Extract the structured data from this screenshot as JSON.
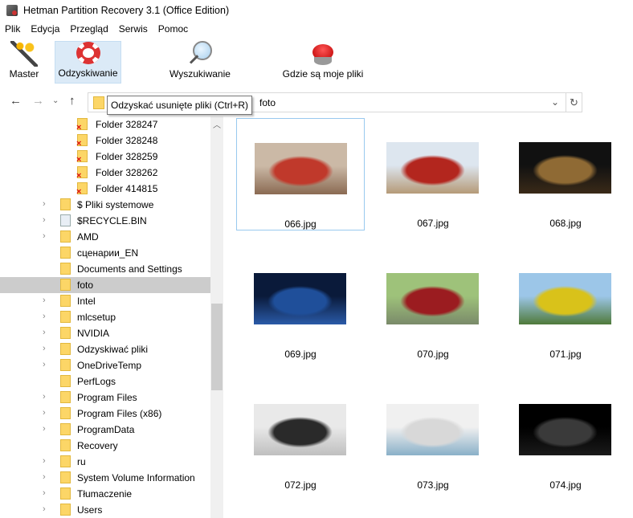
{
  "window": {
    "title": "Hetman Partition Recovery 3.1 (Office Edition)"
  },
  "menu": [
    "Plik",
    "Edycja",
    "Przegląd",
    "Serwis",
    "Pomoc"
  ],
  "toolbar": [
    {
      "label": "Master",
      "icon": "wizard-wand-icon"
    },
    {
      "label": "Odzyskiwanie",
      "icon": "lifebuoy-icon",
      "active": true
    },
    {
      "label": "Wyszukiwanie",
      "icon": "magnifier-icon"
    },
    {
      "label": "Gdzie są moje pliki",
      "icon": "help-button-icon"
    }
  ],
  "address": {
    "current": "foto",
    "separator": "›",
    "tooltip": "Odzyskać usunięte pliki (Ctrl+R)"
  },
  "tree": [
    {
      "label": "Folder 328247",
      "deleted": true
    },
    {
      "label": "Folder 328248",
      "deleted": true
    },
    {
      "label": "Folder 328259",
      "deleted": true
    },
    {
      "label": "Folder 328262",
      "deleted": true
    },
    {
      "label": "Folder 414815",
      "deleted": true
    },
    {
      "label": "$ Pliki systemowe",
      "expandable": true
    },
    {
      "label": "$RECYCLE.BIN",
      "expandable": true,
      "recycle": true
    },
    {
      "label": "AMD",
      "expandable": true
    },
    {
      "label": "сценарии_EN"
    },
    {
      "label": "Documents and Settings"
    },
    {
      "label": "foto",
      "selected": true
    },
    {
      "label": "Intel",
      "expandable": true
    },
    {
      "label": "mlcsetup",
      "expandable": true
    },
    {
      "label": "NVIDIA",
      "expandable": true
    },
    {
      "label": "Odzyskiwać pliki",
      "expandable": true
    },
    {
      "label": "OneDriveTemp",
      "expandable": true
    },
    {
      "label": "PerfLogs"
    },
    {
      "label": "Program Files",
      "expandable": true
    },
    {
      "label": "Program Files (x86)",
      "expandable": true
    },
    {
      "label": "ProgramData",
      "expandable": true
    },
    {
      "label": "Recovery"
    },
    {
      "label": "ru",
      "expandable": true
    },
    {
      "label": "System Volume Information",
      "expandable": true
    },
    {
      "label": "Tłumaczenie",
      "expandable": true
    },
    {
      "label": "Users",
      "expandable": true
    }
  ],
  "files": [
    {
      "name": "066.jpg",
      "selected": true,
      "colors": [
        "#cbb9a6",
        "#8a6a52",
        "#c0392b"
      ]
    },
    {
      "name": "067.jpg",
      "colors": [
        "#dde6ef",
        "#b59a78",
        "#b3261e"
      ]
    },
    {
      "name": "068.jpg",
      "colors": [
        "#111111",
        "#3a2a18",
        "#8f6a34"
      ]
    },
    {
      "name": "069.jpg",
      "colors": [
        "#0a1a3a",
        "#2a5aa8",
        "#1f4f9a"
      ]
    },
    {
      "name": "070.jpg",
      "colors": [
        "#9ec27a",
        "#7a8a6a",
        "#9b1c20"
      ]
    },
    {
      "name": "071.jpg",
      "colors": [
        "#9cc6e8",
        "#4f7a3a",
        "#d9c21a"
      ]
    },
    {
      "name": "072.jpg",
      "colors": [
        "#e9e9e9",
        "#bfbfbf",
        "#2a2a2a"
      ]
    },
    {
      "name": "073.jpg",
      "colors": [
        "#f0f0f0",
        "#8ab0c8",
        "#d8d8d8"
      ]
    },
    {
      "name": "074.jpg",
      "colors": [
        "#000000",
        "#1a1a1a",
        "#3a3a3a"
      ]
    }
  ]
}
